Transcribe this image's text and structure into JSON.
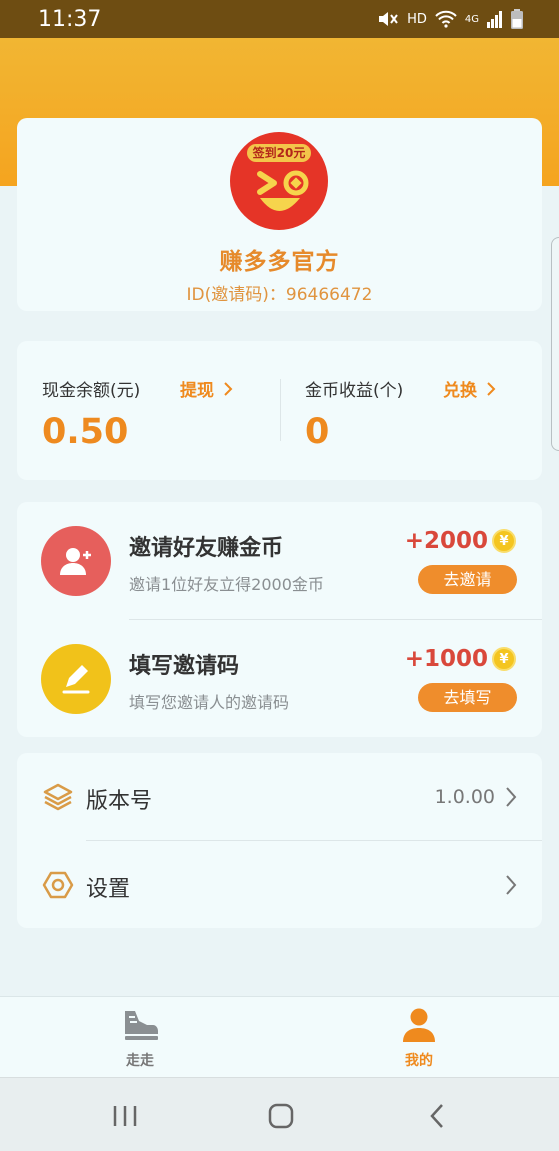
{
  "status_bar": {
    "time": "11:37",
    "hd": "HD",
    "network": "4G"
  },
  "profile": {
    "avatar_tag": "签到20元",
    "name": "赚多多官方",
    "id_text": "ID(邀请码)：96466472"
  },
  "balance": {
    "cash": {
      "label": "现金余额(元)",
      "action": "提现",
      "value": "0.50"
    },
    "coins": {
      "label": "金币收益(个)",
      "action": "兑换",
      "value": "0"
    }
  },
  "tasks": [
    {
      "title": "邀请好友赚金币",
      "desc": "邀请1位好友立得2000金币",
      "reward": "+2000",
      "button": "去邀请",
      "icon": "add-user-icon",
      "icon_color": "#e65f5c"
    },
    {
      "title": "填写邀请码",
      "desc": "填写您邀请人的邀请码",
      "reward": "+1000",
      "button": "去填写",
      "icon": "pencil-icon",
      "icon_color": "#f1c21a"
    }
  ],
  "coin_symbol": "¥",
  "settings": [
    {
      "label": "版本号",
      "value": "1.0.00",
      "icon": "layers-icon"
    },
    {
      "label": "设置",
      "value": "",
      "icon": "settings-hexagon-icon"
    }
  ],
  "bottom_nav": [
    {
      "label": "走走",
      "icon": "sneaker-icon",
      "active": false
    },
    {
      "label": "我的",
      "icon": "user-icon",
      "active": true
    }
  ],
  "colors": {
    "accent": "#ef8d2c",
    "header": "#f5a41f",
    "active": "#ef8a1e",
    "inactive": "#777777"
  }
}
